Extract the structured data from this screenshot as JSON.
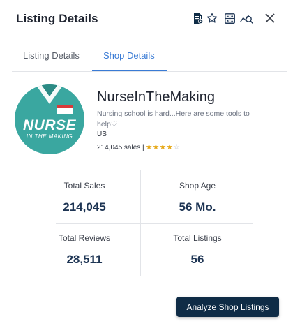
{
  "header": {
    "title": "Listing Details",
    "icons": [
      "document-settings-icon",
      "star-outline-icon",
      "calculator-icon",
      "analytics-search-icon",
      "close-icon"
    ]
  },
  "tabs": [
    {
      "label": "Listing Details",
      "active": false
    },
    {
      "label": "Shop Details",
      "active": true
    }
  ],
  "shop": {
    "logo": {
      "line1": "NURSE",
      "line2": "IN THE MAKING"
    },
    "name": "NurseInTheMaking",
    "description_line1": "Nursing school is hard...Here are some tools to",
    "description_line2": "help♡",
    "country": "US",
    "sales_text": "214,045 sales |",
    "rating_stars": 4,
    "rating_max": 5
  },
  "stats": {
    "total_sales": {
      "label": "Total Sales",
      "value": "214,045"
    },
    "shop_age": {
      "label": "Shop Age",
      "value": "56 Mo."
    },
    "total_reviews": {
      "label": "Total Reviews",
      "value": "28,511"
    },
    "total_listings": {
      "label": "Total Listings",
      "value": "56"
    }
  },
  "actions": {
    "analyze_label": "Analyze Shop Listings"
  },
  "colors": {
    "accent": "#3a7bd5",
    "button_bg": "#0f2c46",
    "logo_bg": "#3aa7a0",
    "star": "#e6a817"
  }
}
